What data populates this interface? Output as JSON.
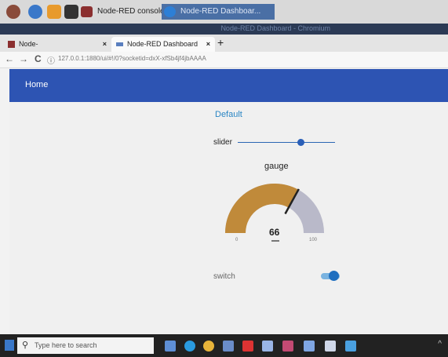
{
  "os_taskbar": {
    "tasks": [
      {
        "label": "Node-RED console"
      },
      {
        "label": "Node-RED Dashboar..."
      }
    ]
  },
  "browser": {
    "window_title": "Node-RED Dashboard - Chromium",
    "tabs": [
      {
        "label": "Node-"
      },
      {
        "label": "Node-RED Dashboard"
      }
    ],
    "url": "127.0.0.1:1880/ui/#!/0?socketid=dxX-xfSb4jf4jbAAAA",
    "nav": {
      "back": "←",
      "forward": "→",
      "reload": "C",
      "info": "ⓘ"
    },
    "new_tab": "+",
    "tab_close": "×"
  },
  "dashboard": {
    "header_title": "Home",
    "group_title": "Default",
    "slider": {
      "label": "slider",
      "value": 0.65
    },
    "gauge": {
      "title": "gauge",
      "value": "66",
      "min": "0",
      "max": "100",
      "value_num": 66,
      "fill_color": "#c08a3a",
      "track_color": "#b9b9c9"
    },
    "switch": {
      "label": "switch",
      "on": true
    }
  },
  "windows_taskbar": {
    "search_placeholder": "Type here to search"
  },
  "colors": {
    "header": "#2d54b3",
    "accent": "#2a86c4"
  }
}
